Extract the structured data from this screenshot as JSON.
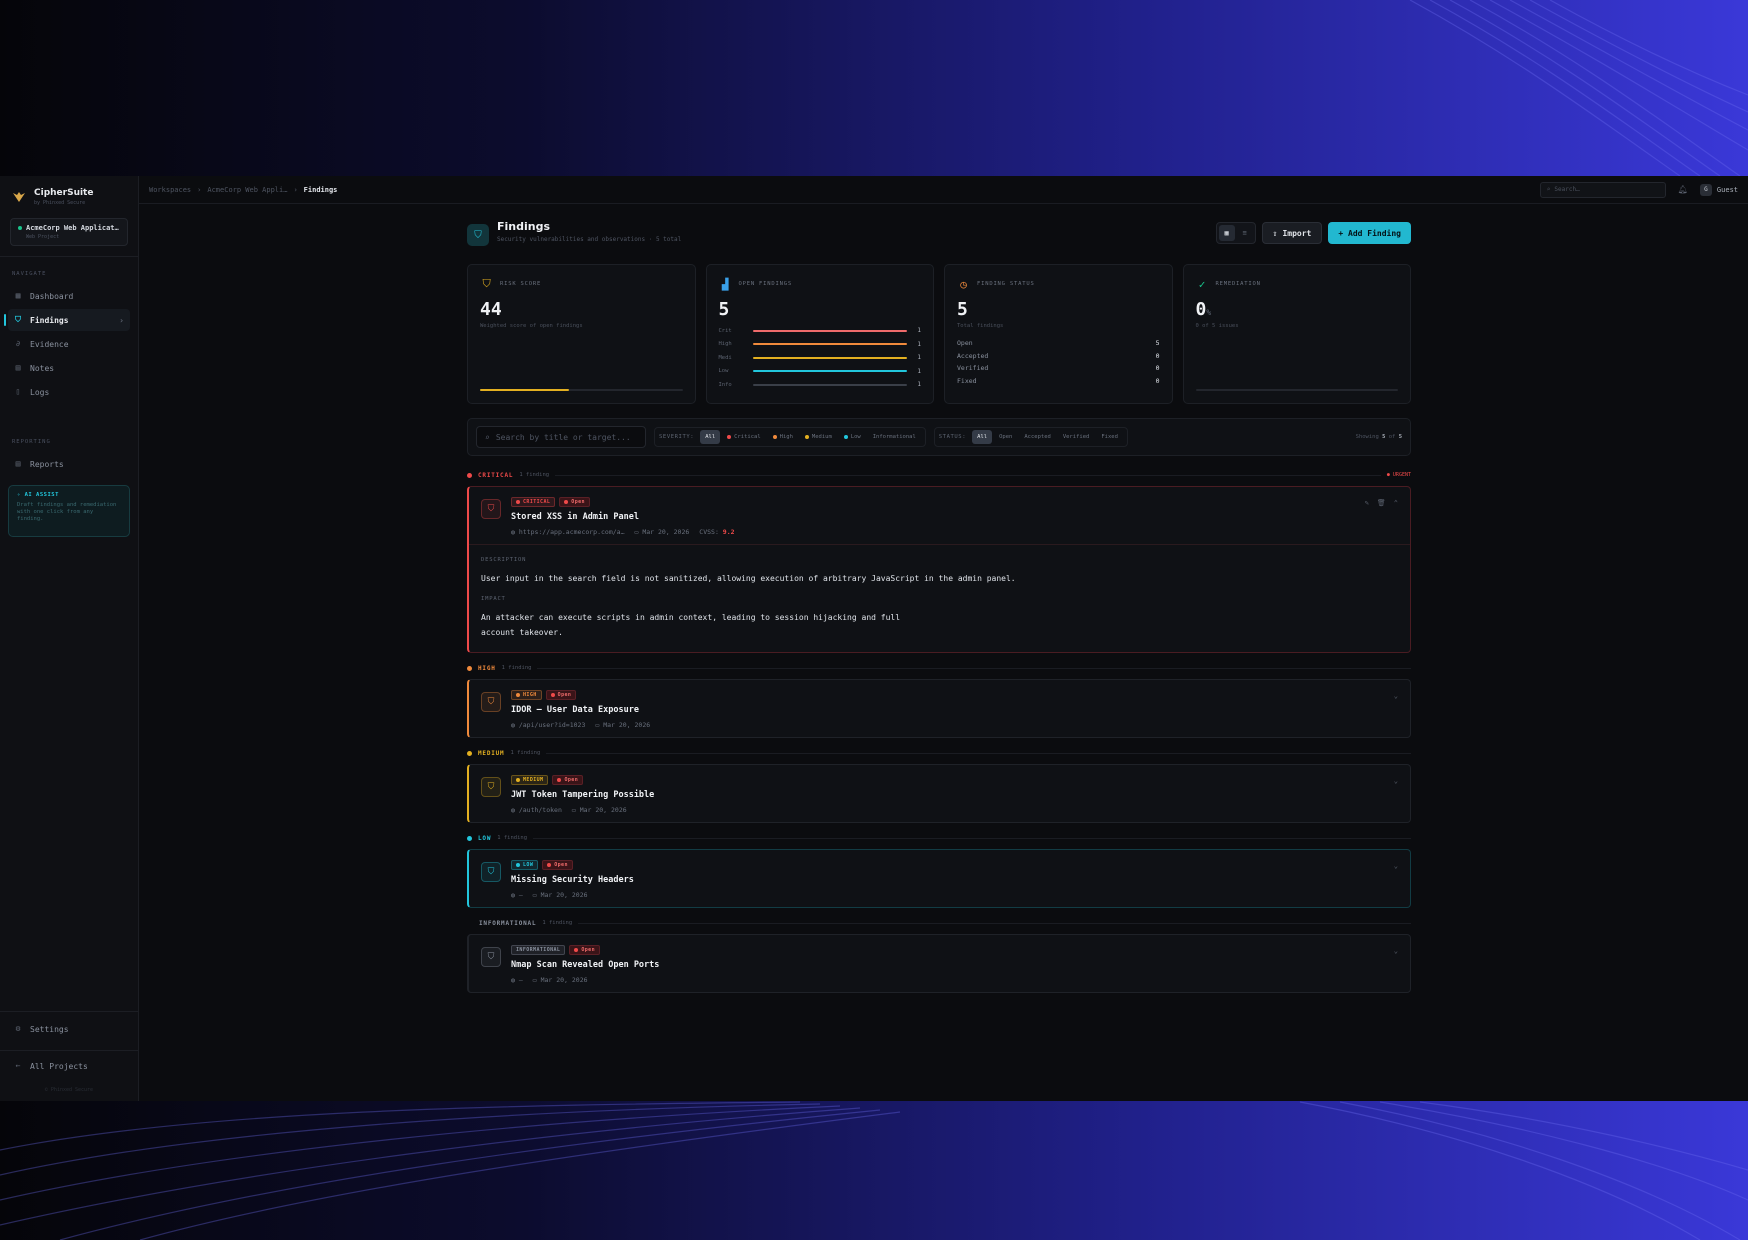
{
  "brand": {
    "name": "CipherSuite",
    "sub": "by Phinxed Secure"
  },
  "project": {
    "name": "AcmeCorp Web Applicat…",
    "sub": "Web Project"
  },
  "sidebar": {
    "navigate_label": "NAVIGATE",
    "items": [
      {
        "label": "Dashboard",
        "icon": "grid-icon"
      },
      {
        "label": "Findings",
        "icon": "shield-icon"
      },
      {
        "label": "Evidence",
        "icon": "paperclip-icon"
      },
      {
        "label": "Notes",
        "icon": "note-icon"
      },
      {
        "label": "Logs",
        "icon": "file-icon"
      }
    ],
    "reporting_label": "REPORTING",
    "reports_label": "Reports",
    "ai": {
      "title": "AI ASSIST",
      "text": "Draft findings and remediation with one click from any finding."
    },
    "settings_label": "Settings",
    "all_projects_label": "All Projects",
    "footer": "© Phinxed Secure"
  },
  "breadcrumbs": {
    "a": "Workspaces",
    "b": "AcmeCorp Web Appli…",
    "current": "Findings"
  },
  "top": {
    "search_placeholder": "Search…",
    "user": "Guest",
    "user_initial": "G"
  },
  "page": {
    "title": "Findings",
    "subtitle": "Security vulnerabilities and observations · 5 total",
    "import_label": "Import",
    "add_label": "+ Add Finding"
  },
  "stats": {
    "risk": {
      "label": "RISK SCORE",
      "value": "44",
      "sub": "Weighted score of open findings",
      "fraction": 0.44
    },
    "open": {
      "label": "OPEN FINDINGS",
      "value": "5",
      "rows": [
        {
          "label": "Crit",
          "count": "1",
          "color": "#ef6b6b"
        },
        {
          "label": "High",
          "count": "1",
          "color": "#f08a3c"
        },
        {
          "label": "Medi",
          "count": "1",
          "color": "#e3b021"
        },
        {
          "label": "Low",
          "count": "1",
          "color": "#22c6dc"
        },
        {
          "label": "Info",
          "count": "1",
          "color": "#3a3f48"
        }
      ]
    },
    "status": {
      "label": "FINDING STATUS",
      "value": "5",
      "sub": "Total findings",
      "rows": [
        {
          "label": "Open",
          "count": "5"
        },
        {
          "label": "Accepted",
          "count": "0"
        },
        {
          "label": "Verified",
          "count": "0"
        },
        {
          "label": "Fixed",
          "count": "0"
        }
      ]
    },
    "remediation": {
      "label": "REMEDIATION",
      "value": "0",
      "unit": "%",
      "sub": "0 of 5 issues",
      "fraction": 0
    }
  },
  "filters": {
    "search_placeholder": "Search by title or target...",
    "severity_label": "SEVERITY:",
    "severity": [
      "All",
      "Critical",
      "High",
      "Medium",
      "Low",
      "Informational"
    ],
    "status_label": "STATUS:",
    "status": [
      "All",
      "Open",
      "Accepted",
      "Verified",
      "Fixed"
    ],
    "showing_prefix": "Showing",
    "showing_n": "5",
    "showing_of": "of",
    "showing_total": "5"
  },
  "groups": [
    {
      "name": "CRITICAL",
      "count": "1 finding",
      "color": "#ef4a4a",
      "tag": "● URGENT",
      "finding": {
        "severity": "CRITICAL",
        "status": "Open",
        "title": "Stored XSS in Admin Panel",
        "target": "https://app.acmecorp.com/a…",
        "date": "Mar 20, 2026",
        "cvss_label": "CVSS:",
        "cvss": "9.2",
        "description_label": "DESCRIPTION",
        "description": "User input in the search field is not sanitized, allowing execution of arbitrary JavaScript in the admin panel.",
        "impact_label": "IMPACT",
        "impact_1": "An attacker can execute scripts in admin context, leading to session hijacking and full",
        "impact_2": "account takeover."
      }
    },
    {
      "name": "HIGH",
      "count": "1 finding",
      "color": "#f08a3c",
      "finding": {
        "severity": "HIGH",
        "status": "Open",
        "title": "IDOR — User Data Exposure",
        "target": "/api/user?id=1023",
        "date": "Mar 20, 2026"
      }
    },
    {
      "name": "MEDIUM",
      "count": "1 finding",
      "color": "#e3b021",
      "finding": {
        "severity": "MEDIUM",
        "status": "Open",
        "title": "JWT Token Tampering Possible",
        "target": "/auth/token",
        "date": "Mar 20, 2026"
      }
    },
    {
      "name": "LOW",
      "count": "1 finding",
      "color": "#22c6dc",
      "finding": {
        "severity": "LOW",
        "status": "Open",
        "title": "Missing Security Headers",
        "target": "—",
        "date": "Mar 20, 2026"
      }
    },
    {
      "name": "INFORMATIONAL",
      "count": "1 finding",
      "color": "#8a919e",
      "finding": {
        "severity": "INFORMATIONAL",
        "status": "Open",
        "title": "Nmap Scan Revealed Open Ports",
        "target": "—",
        "date": "Mar 20, 2026"
      }
    }
  ]
}
